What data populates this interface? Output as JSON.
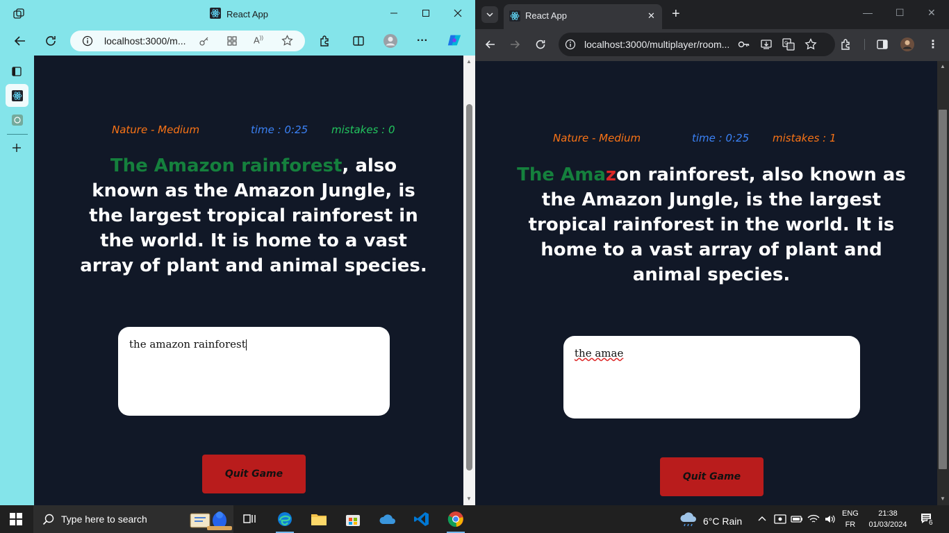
{
  "left_window": {
    "title": "React App",
    "url": "localhost:3000/m...",
    "game": {
      "category": "Nature - Medium",
      "time": "time : 0:25",
      "mistakes": "mistakes : 0",
      "passage_typed": "The Amazon rainforest",
      "passage_error": "",
      "passage_rest": ", also known as the Amazon Jungle, is the largest tropical rainforest in the world. It is home to a vast array of plant and animal species.",
      "input_value": "the amazon rainforest",
      "quit_label": "Quit Game"
    }
  },
  "right_window": {
    "title": "React App",
    "url": "localhost:3000/multiplayer/room...",
    "game": {
      "category": "Nature - Medium",
      "time": "time : 0:25",
      "mistakes": "mistakes : 1",
      "passage_typed": "The Ama",
      "passage_error": "z",
      "passage_rest": "on rainforest, also known as the Amazon Jungle, is the largest tropical rainforest in the world. It is home to a vast array of plant and animal species.",
      "input_value": "the amae",
      "quit_label": "Quit Game"
    }
  },
  "taskbar": {
    "search_placeholder": "Type here to search",
    "weather": "6°C  Rain",
    "lang_top": "ENG",
    "lang_bottom": "FR",
    "time": "21:38",
    "date": "01/03/2024",
    "notification_count": "6"
  },
  "colors": {
    "edge_frame": "#84e4ea",
    "page_bg": "#111827",
    "correct_text": "#15803d",
    "error_text": "#dc2626",
    "quit_button": "#b91c1c"
  }
}
